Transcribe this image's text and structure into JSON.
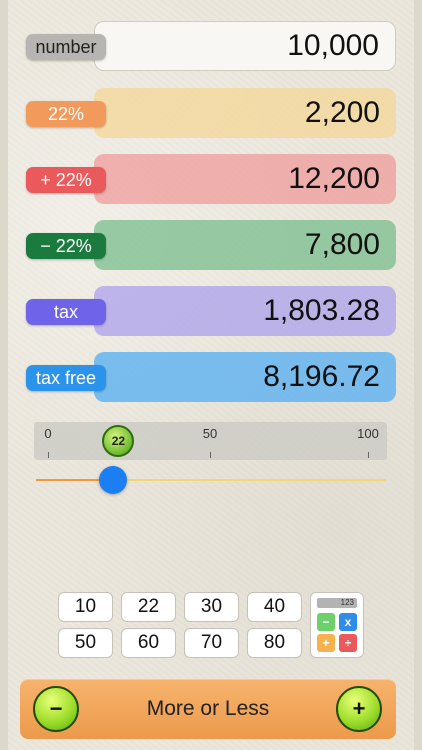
{
  "rows": [
    {
      "label": "number",
      "value": "10,000"
    },
    {
      "label": "22%",
      "value": "2,200"
    },
    {
      "label": "+ 22%",
      "value": "12,200"
    },
    {
      "label": "− 22%",
      "value": "7,800"
    },
    {
      "label": "tax",
      "value": "1,803.28"
    },
    {
      "label": "tax free",
      "value": "8,196.72"
    }
  ],
  "scale": {
    "min": "0",
    "mid": "50",
    "max": "100"
  },
  "slider": {
    "value": "22",
    "value_fraction": 0.22
  },
  "presets": [
    "10",
    "22",
    "30",
    "40",
    "50",
    "60",
    "70",
    "80"
  ],
  "calculator": {
    "screen": "123",
    "keys": [
      "−",
      "x",
      "+",
      "÷"
    ]
  },
  "bottom": {
    "label": "More or Less",
    "minus": "−",
    "plus": "+"
  },
  "colors": {
    "percent": "#f19a5c",
    "plus": "#ea5a5d",
    "minus": "#1b7b3e",
    "tax": "#6f63ea",
    "tax_free": "#2b93ea",
    "slider_knob": "#1b7ef2",
    "bar": "#ec9a4b"
  }
}
